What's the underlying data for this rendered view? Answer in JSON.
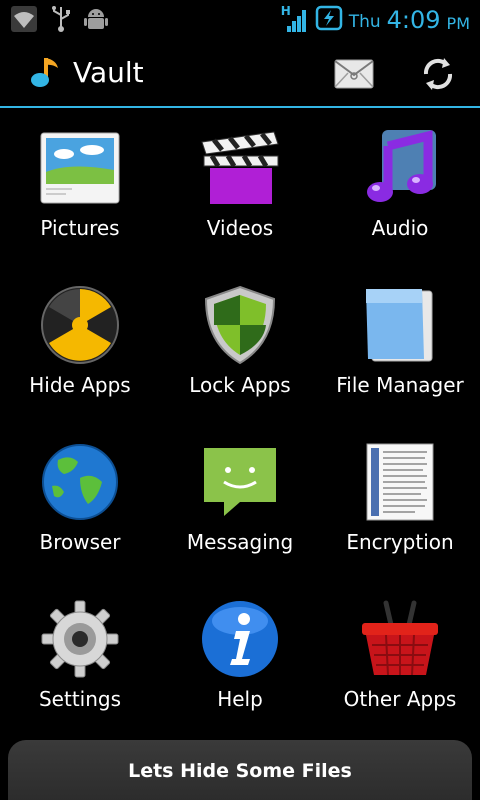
{
  "status_bar": {
    "network_type": "H",
    "day": "Thu",
    "time": "4:09",
    "ampm": "PM",
    "icons": [
      "wifi-icon",
      "usb-icon",
      "android-debug-icon",
      "signal-icon",
      "battery-charging-icon"
    ]
  },
  "action_bar": {
    "title": "Vault",
    "logo_icon": "music-note-icon",
    "actions": [
      {
        "name": "mail-icon",
        "label": "Messages"
      },
      {
        "name": "sync-icon",
        "label": "Sync"
      }
    ],
    "accent_color": "#33b5e5"
  },
  "grid": {
    "items": [
      {
        "label": "Pictures",
        "icon": "pictures-icon"
      },
      {
        "label": "Videos",
        "icon": "videos-icon"
      },
      {
        "label": "Audio",
        "icon": "audio-icon"
      },
      {
        "label": "Hide Apps",
        "icon": "hide-apps-icon"
      },
      {
        "label": "Lock Apps",
        "icon": "lock-apps-icon"
      },
      {
        "label": "File Manager",
        "icon": "file-manager-icon"
      },
      {
        "label": "Browser",
        "icon": "browser-icon"
      },
      {
        "label": "Messaging",
        "icon": "messaging-icon"
      },
      {
        "label": "Encryption",
        "icon": "encryption-icon"
      },
      {
        "label": "Settings",
        "icon": "settings-icon"
      },
      {
        "label": "Help",
        "icon": "help-icon"
      },
      {
        "label": "Other Apps",
        "icon": "other-apps-icon"
      }
    ]
  },
  "toast": {
    "text": "Lets Hide Some Files"
  }
}
